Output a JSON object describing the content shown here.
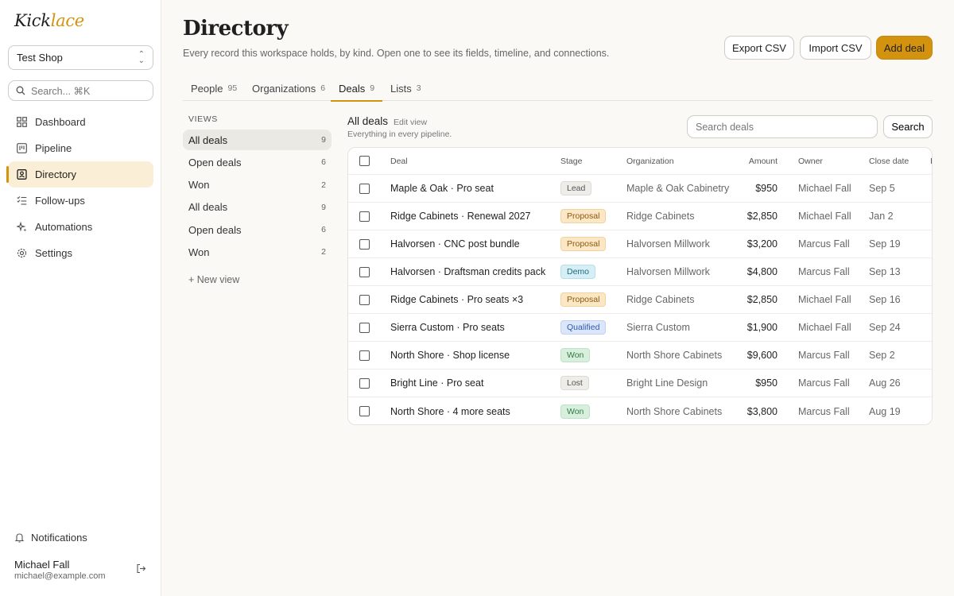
{
  "app": {
    "logo_main": "Kick",
    "logo_accent": "lace",
    "workspace": "Test Shop",
    "search_placeholder": "Search...  ⌘K",
    "accent_color": "#d4930f"
  },
  "sidebar": {
    "items": [
      {
        "label": "Dashboard",
        "icon": "grid-icon"
      },
      {
        "label": "Pipeline",
        "icon": "kanban-icon"
      },
      {
        "label": "Directory",
        "icon": "contact-book-icon",
        "active": true
      },
      {
        "label": "Follow-ups",
        "icon": "checklist-icon"
      },
      {
        "label": "Automations",
        "icon": "sparkle-icon"
      },
      {
        "label": "Settings",
        "icon": "gear-icon"
      }
    ],
    "notifications": "Notifications",
    "user_name": "Michael Fall",
    "user_email": "michael@example.com"
  },
  "header": {
    "title": "Directory",
    "subtitle": "Every record this workspace holds, by kind. Open one to see its fields, timeline, and connections.",
    "export_label": "Export CSV",
    "import_label": "Import CSV",
    "add_label": "Add deal"
  },
  "tabs": [
    {
      "label": "People",
      "count": "95"
    },
    {
      "label": "Organizations",
      "count": "6"
    },
    {
      "label": "Deals",
      "count": "9",
      "active": true
    },
    {
      "label": "Lists",
      "count": "3"
    }
  ],
  "views": {
    "heading": "VIEWS",
    "items": [
      {
        "label": "All deals",
        "count": "9",
        "active": true
      },
      {
        "label": "Open deals",
        "count": "6"
      },
      {
        "label": "Won",
        "count": "2"
      },
      {
        "label": "All deals",
        "count": "9"
      },
      {
        "label": "Open deals",
        "count": "6"
      },
      {
        "label": "Won",
        "count": "2"
      }
    ],
    "new_view": "+ New view"
  },
  "list": {
    "title": "All deals",
    "edit_view": "Edit view",
    "subtitle": "Everything in every pipeline.",
    "search_placeholder": "Search deals",
    "search_button": "Search"
  },
  "table": {
    "columns": [
      "Deal",
      "Stage",
      "Organization",
      "Amount",
      "Owner",
      "Close date",
      "I"
    ],
    "rows": [
      {
        "deal": "Maple & Oak · Pro seat",
        "stage": "Lead",
        "org": "Maple & Oak Cabinetry",
        "amount": "$950",
        "owner": "Michael Fall",
        "close": "Sep 5"
      },
      {
        "deal": "Ridge Cabinets · Renewal 2027",
        "stage": "Proposal",
        "org": "Ridge Cabinets",
        "amount": "$2,850",
        "owner": "Michael Fall",
        "close": "Jan 2"
      },
      {
        "deal": "Halvorsen · CNC post bundle",
        "stage": "Proposal",
        "org": "Halvorsen Millwork",
        "amount": "$3,200",
        "owner": "Marcus Fall",
        "close": "Sep 19"
      },
      {
        "deal": "Halvorsen · Draftsman credits pack",
        "stage": "Demo",
        "org": "Halvorsen Millwork",
        "amount": "$4,800",
        "owner": "Marcus Fall",
        "close": "Sep 13"
      },
      {
        "deal": "Ridge Cabinets · Pro seats ×3",
        "stage": "Proposal",
        "org": "Ridge Cabinets",
        "amount": "$2,850",
        "owner": "Michael Fall",
        "close": "Sep 16"
      },
      {
        "deal": "Sierra Custom · Pro seats",
        "stage": "Qualified",
        "org": "Sierra Custom",
        "amount": "$1,900",
        "owner": "Michael Fall",
        "close": "Sep 24"
      },
      {
        "deal": "North Shore · Shop license",
        "stage": "Won",
        "org": "North Shore Cabinets",
        "amount": "$9,600",
        "owner": "Marcus Fall",
        "close": "Sep 2"
      },
      {
        "deal": "Bright Line · Pro seat",
        "stage": "Lost",
        "org": "Bright Line Design",
        "amount": "$950",
        "owner": "Marcus Fall",
        "close": "Aug 26"
      },
      {
        "deal": "North Shore · 4 more seats",
        "stage": "Won",
        "org": "North Shore Cabinets",
        "amount": "$3,800",
        "owner": "Marcus Fall",
        "close": "Aug 19"
      }
    ]
  }
}
